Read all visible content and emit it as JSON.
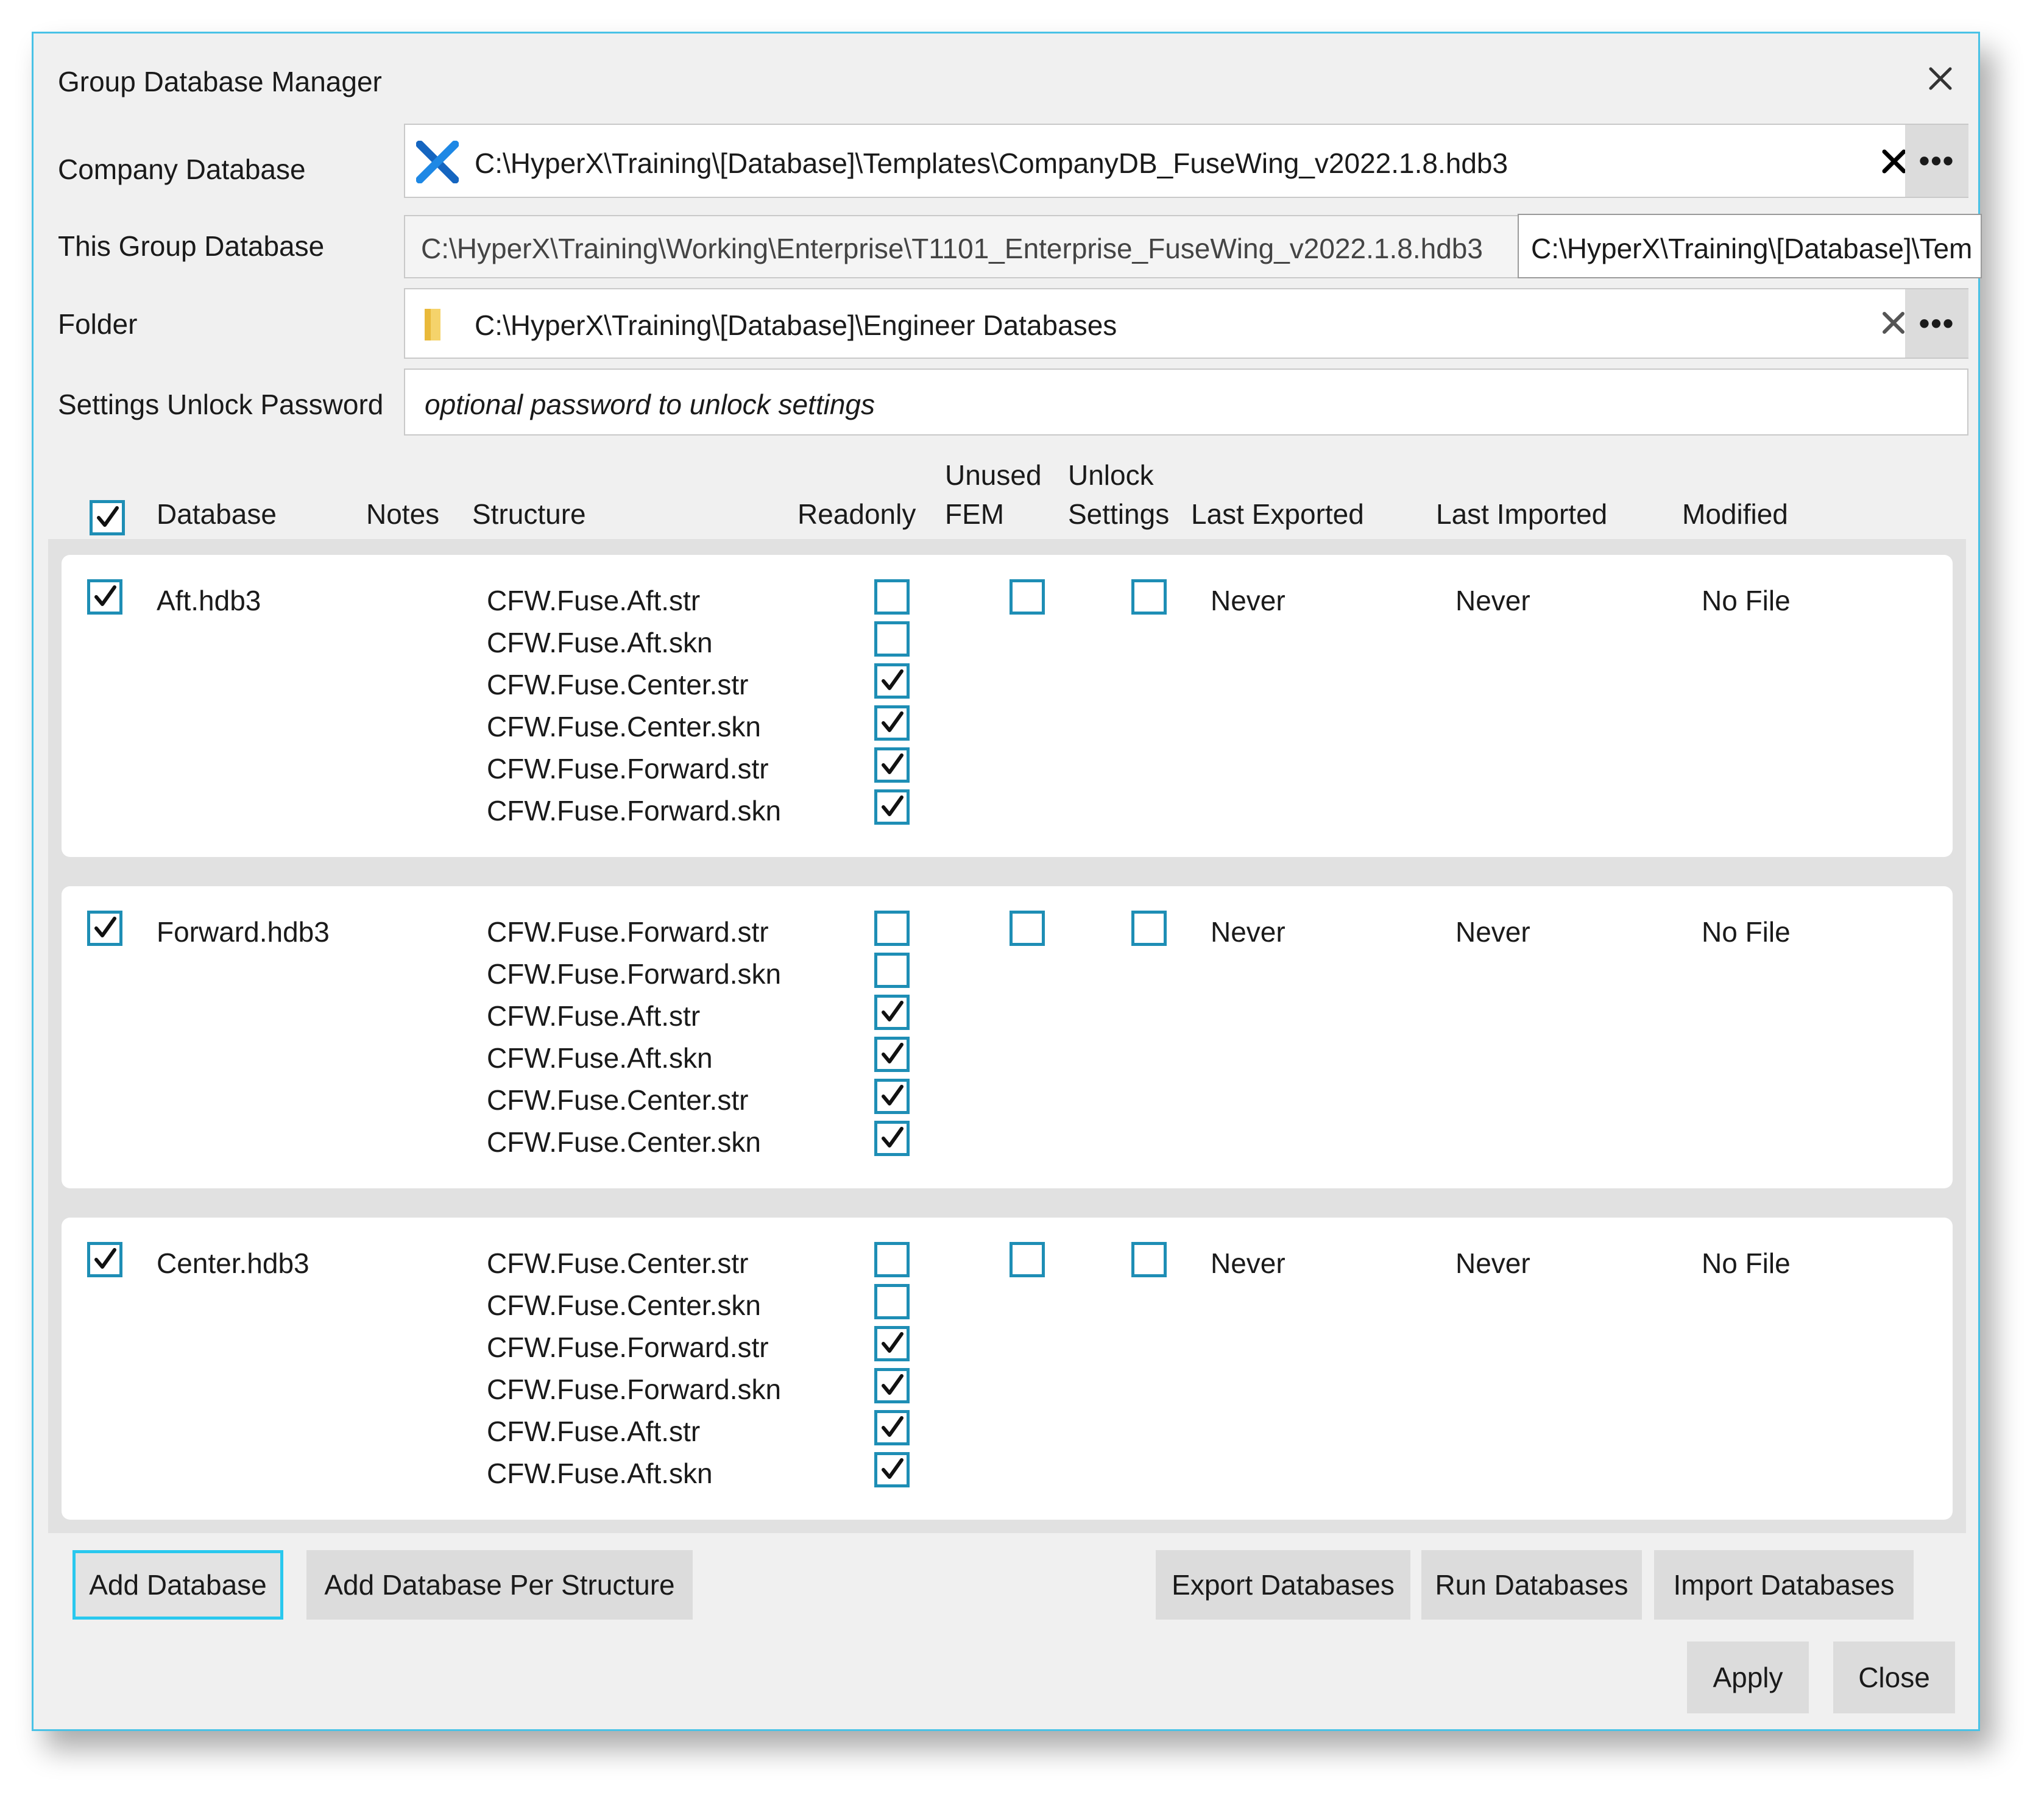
{
  "window": {
    "title": "Group Database Manager"
  },
  "icons": {
    "close": "close-icon",
    "app": "x-logo-icon",
    "folder": "folder-icon",
    "clear": "clear-icon",
    "browse": "ellipsis-icon",
    "check": "checkmark-icon"
  },
  "colors": {
    "accent": "#1e8eb5",
    "focus": "#29c8ee",
    "logo": "#1565c0",
    "folder": "#f5d36b"
  },
  "form": {
    "company_label": "Company Database",
    "company_value": "C:\\HyperX\\Training\\[Database]\\Templates\\CompanyDB_FuseWing_v2022.1.8.hdb3",
    "group_label": "This Group Database",
    "group_value": "C:\\HyperX\\Training\\Working\\Enterprise\\T1101_Enterprise_FuseWing_v2022.1.8.hdb3",
    "tooltip": "C:\\HyperX\\Training\\[Database]\\Tem",
    "folder_label": "Folder",
    "folder_value": "C:\\HyperX\\Training\\[Database]\\Engineer Databases",
    "password_label": "Settings Unlock Password",
    "password_placeholder": "optional password to unlock settings",
    "browse_label": "•••"
  },
  "columns": {
    "database": "Database",
    "notes": "Notes",
    "structure": "Structure",
    "readonly": "Readonly",
    "unused_fem_1": "Unused",
    "unused_fem_2": "FEM",
    "unlock_1": "Unlock",
    "unlock_2": "Settings",
    "last_exported": "Last Exported",
    "last_imported": "Last Imported",
    "modified": "Modified"
  },
  "header_checked": true,
  "databases": [
    {
      "name": "Aft.hdb3",
      "checked": true,
      "unused_fem": false,
      "unlock": false,
      "last_exported": "Never",
      "last_imported": "Never",
      "modified": "No File",
      "structures": [
        {
          "name": "CFW.Fuse.Aft.str",
          "readonly": false
        },
        {
          "name": "CFW.Fuse.Aft.skn",
          "readonly": false
        },
        {
          "name": "CFW.Fuse.Center.str",
          "readonly": true
        },
        {
          "name": "CFW.Fuse.Center.skn",
          "readonly": true
        },
        {
          "name": "CFW.Fuse.Forward.str",
          "readonly": true
        },
        {
          "name": "CFW.Fuse.Forward.skn",
          "readonly": true
        }
      ]
    },
    {
      "name": "Forward.hdb3",
      "checked": true,
      "unused_fem": false,
      "unlock": false,
      "last_exported": "Never",
      "last_imported": "Never",
      "modified": "No File",
      "structures": [
        {
          "name": "CFW.Fuse.Forward.str",
          "readonly": false
        },
        {
          "name": "CFW.Fuse.Forward.skn",
          "readonly": false
        },
        {
          "name": "CFW.Fuse.Aft.str",
          "readonly": true
        },
        {
          "name": "CFW.Fuse.Aft.skn",
          "readonly": true
        },
        {
          "name": "CFW.Fuse.Center.str",
          "readonly": true
        },
        {
          "name": "CFW.Fuse.Center.skn",
          "readonly": true
        }
      ]
    },
    {
      "name": "Center.hdb3",
      "checked": true,
      "unused_fem": false,
      "unlock": false,
      "last_exported": "Never",
      "last_imported": "Never",
      "modified": "No File",
      "structures": [
        {
          "name": "CFW.Fuse.Center.str",
          "readonly": false
        },
        {
          "name": "CFW.Fuse.Center.skn",
          "readonly": false
        },
        {
          "name": "CFW.Fuse.Forward.str",
          "readonly": true
        },
        {
          "name": "CFW.Fuse.Forward.skn",
          "readonly": true
        },
        {
          "name": "CFW.Fuse.Aft.str",
          "readonly": true
        },
        {
          "name": "CFW.Fuse.Aft.skn",
          "readonly": true
        }
      ]
    }
  ],
  "buttons": {
    "add_database": "Add Database",
    "add_per_structure": "Add Database Per Structure",
    "export": "Export Databases",
    "run": "Run Databases",
    "import": "Import Databases",
    "apply": "Apply",
    "close": "Close"
  }
}
